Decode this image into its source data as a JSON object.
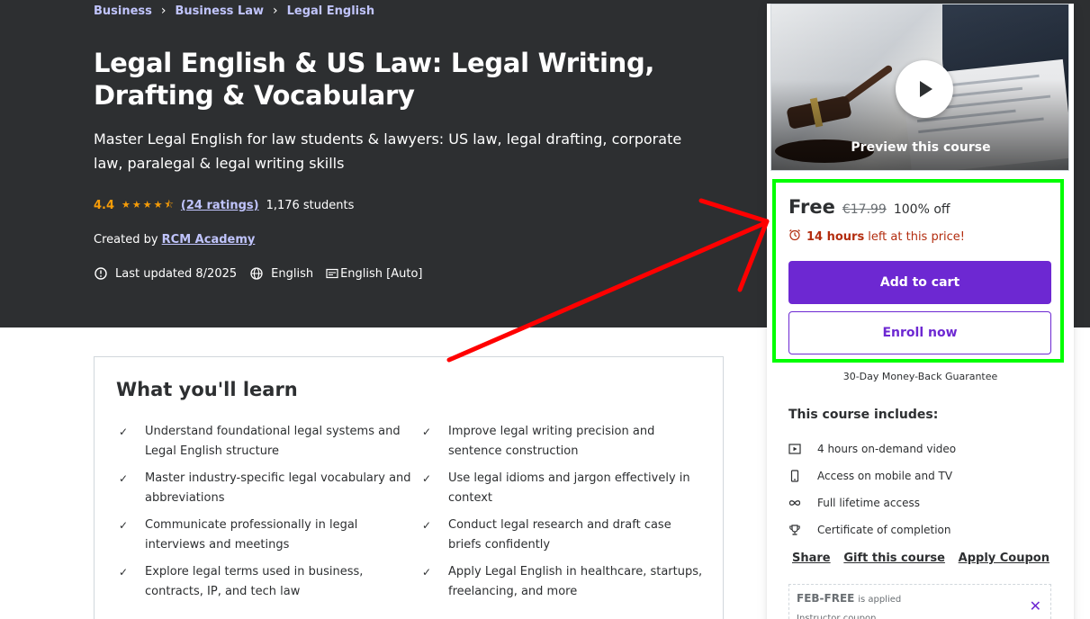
{
  "breadcrumbs": [
    "Business",
    "Business Law",
    "Legal English"
  ],
  "course": {
    "title": "Legal English & US Law: Legal Writing, Drafting & Vocabulary",
    "subtitle": "Master Legal English for law students & lawyers: US law, legal drafting, corporate law, paralegal & legal writing skills",
    "rating": "4.4",
    "stars": "★★★★⯪",
    "ratings_text": "(24 ratings)",
    "students": "1,176 students",
    "created_by_label": "Created by",
    "instructor": "RCM Academy",
    "last_updated": "Last updated 8/2025",
    "language": "English",
    "captions": "English [Auto]"
  },
  "learn": {
    "title": "What you'll learn",
    "items": [
      "Understand foundational legal systems and Legal English structure",
      "Improve legal writing precision and sentence construction",
      "Master industry-specific legal vocabulary and abbreviations",
      "Use legal idioms and jargon effectively in context",
      "Communicate professionally in legal interviews and meetings",
      "Conduct legal research and draft case briefs confidently",
      "Explore legal terms used in business, contracts, IP, and tech law",
      "Apply Legal English in healthcare, startups, freelancing, and more"
    ]
  },
  "sidebar": {
    "preview_label": "Preview this course",
    "price": "Free",
    "original_price": "€17.99",
    "discount": "100% off",
    "timer_hours": "14 hours",
    "timer_suffix": "left at this price!",
    "add_to_cart": "Add to cart",
    "enroll_now": "Enroll now",
    "guarantee": "30-Day Money-Back Guarantee",
    "includes_title": "This course includes:",
    "includes": [
      {
        "icon": "video-icon",
        "label": "4 hours on-demand video"
      },
      {
        "icon": "mobile-icon",
        "label": "Access on mobile and TV"
      },
      {
        "icon": "infinity-icon",
        "label": "Full lifetime access"
      },
      {
        "icon": "trophy-icon",
        "label": "Certificate of completion"
      }
    ],
    "links": [
      "Share",
      "Gift this course",
      "Apply Coupon"
    ],
    "coupon_code": "FEB-FREE",
    "coupon_status": "is applied",
    "coupon_type": "Instructor coupon"
  },
  "colors": {
    "hero_bg": "#2d2f31",
    "accent": "#6d28d2",
    "link": "#c0c4fc",
    "star": "#f69c08",
    "timer": "#b32d0f",
    "annotation_box": "#00ff00",
    "annotation_arrow": "#ff0000"
  }
}
